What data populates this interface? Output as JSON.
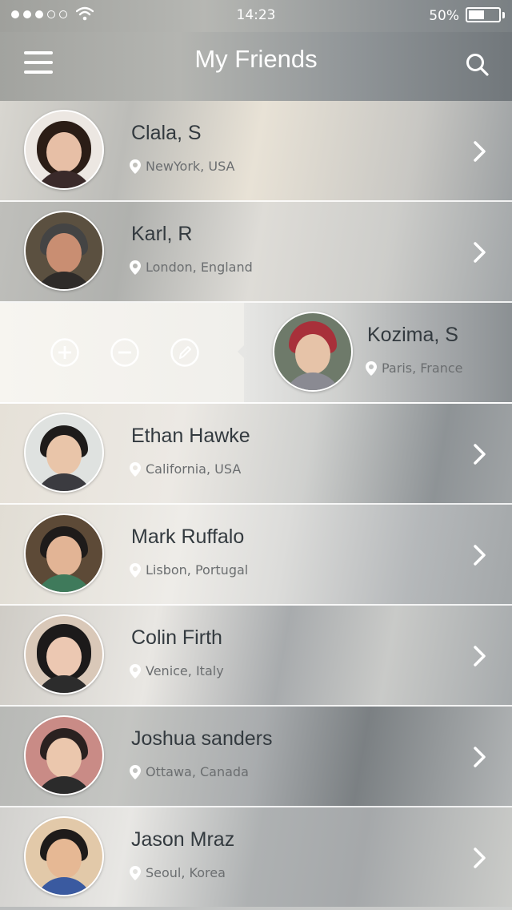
{
  "status": {
    "time": "14:23",
    "battery": "50%",
    "battery_level": 0.5,
    "signal_bars": 3,
    "signal_total": 5
  },
  "nav": {
    "title": "My Friends",
    "menu_icon": "hamburger-menu-icon",
    "search_icon": "search-icon"
  },
  "friends": [
    {
      "name": "Clala, S",
      "location": "NewYork, USA"
    },
    {
      "name": "Karl, R",
      "location": "London, England"
    },
    {
      "name": "Kozima, S",
      "location": "Paris, France"
    },
    {
      "name": "Ethan Hawke",
      "location": "California, USA"
    },
    {
      "name": "Mark Ruffalo",
      "location": "Lisbon, Portugal"
    },
    {
      "name": "Colin Firth",
      "location": "Venice, Italy"
    },
    {
      "name": "Joshua sanders",
      "location": "Ottawa, Canada"
    },
    {
      "name": "Jason Mraz",
      "location": "Seoul, Korea"
    }
  ],
  "swipe_actions": [
    "add-icon",
    "remove-icon",
    "edit-icon"
  ],
  "colors": {
    "text_dark": "#333a3f",
    "text_muted": "#6b6e70",
    "white": "#ffffff"
  }
}
